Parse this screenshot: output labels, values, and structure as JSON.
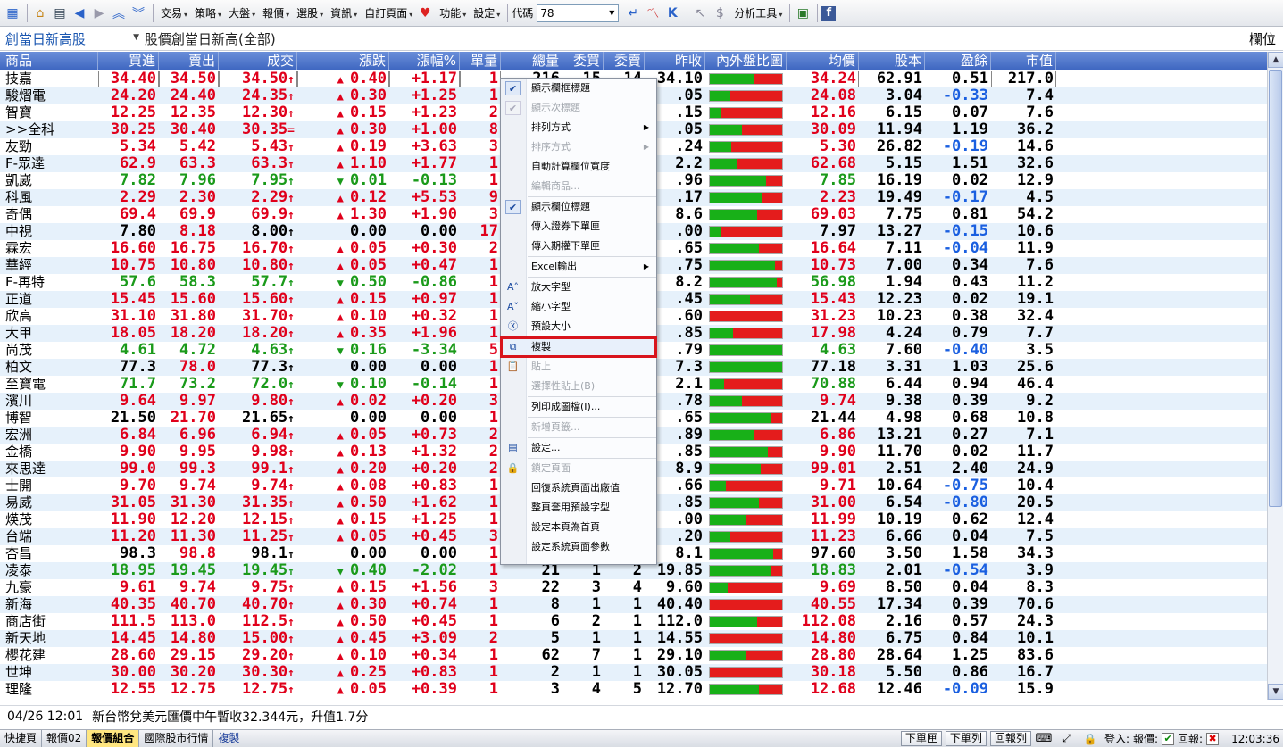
{
  "toolbar": {
    "menus": [
      "交易",
      "策略",
      "大盤",
      "報價",
      "選股",
      "資訊",
      "自訂頁面",
      "功能",
      "設定"
    ],
    "code_label": "代碼",
    "code_value": "78",
    "analysis_tools": "分析工具"
  },
  "page": {
    "selector": "創當日新高股",
    "title": "股價創當日新高(全部)",
    "columns_button": "欄位"
  },
  "columns": [
    "商品",
    "買進",
    "賣出",
    "成交",
    "漲跌",
    "漲幅%",
    "單量",
    "總量",
    "委買",
    "委賣",
    "昨收",
    "內外盤比圖",
    "均價",
    "股本",
    "盈餘",
    "市值"
  ],
  "rows": [
    {
      "name": "技嘉",
      "bid": "34.40",
      "ask": "34.50",
      "last": "34.50",
      "lastMark": "↑",
      "chg": "0.40",
      "dir": "up",
      "pct": "+1.17",
      "vol": "1",
      "total": "216",
      "bq": "15",
      "aq": "14",
      "prev": "34.10",
      "green": 0.62,
      "avg": "34.24",
      "cap": "62.91",
      "eps": "0.51",
      "mv": "217.0"
    },
    {
      "name": "駿熠電",
      "bid": "24.20",
      "ask": "24.40",
      "last": "24.35",
      "lastMark": "↑",
      "chg": "0.30",
      "dir": "up",
      "pct": "+1.25",
      "vol": "1",
      "total": "",
      "bq": "",
      "aq": "",
      "prev": ".05",
      "green": 0.28,
      "avg": "24.08",
      "cap": "3.04",
      "eps": "-0.33",
      "mv": "7.4"
    },
    {
      "name": "智寶",
      "bid": "12.25",
      "ask": "12.35",
      "last": "12.30",
      "lastMark": "↑",
      "chg": "0.15",
      "dir": "up",
      "pct": "+1.23",
      "vol": "2",
      "total": "",
      "bq": "",
      "aq": "",
      "prev": ".15",
      "green": 0.15,
      "avg": "12.16",
      "cap": "6.15",
      "eps": "0.07",
      "mv": "7.6"
    },
    {
      "name": ">>全科",
      "bid": "30.25",
      "ask": "30.40",
      "last": "30.35",
      "lastMark": "=",
      "chg": "0.30",
      "dir": "up",
      "pct": "+1.00",
      "vol": "8",
      "total": "",
      "bq": "",
      "aq": "",
      "prev": ".05",
      "green": 0.45,
      "avg": "30.09",
      "cap": "11.94",
      "eps": "1.19",
      "mv": "36.2"
    },
    {
      "name": "友勁",
      "bid": "5.34",
      "ask": "5.42",
      "last": "5.43",
      "lastMark": "↑",
      "chg": "0.19",
      "dir": "up",
      "pct": "+3.63",
      "vol": "3",
      "total": "",
      "bq": "",
      "aq": "",
      "prev": ".24",
      "green": 0.3,
      "avg": "5.30",
      "cap": "26.82",
      "eps": "-0.19",
      "mv": "14.6"
    },
    {
      "name": "F-眾達",
      "bid": "62.9",
      "ask": "63.3",
      "last": "63.3",
      "lastMark": "↑",
      "chg": "1.10",
      "dir": "up",
      "pct": "+1.77",
      "vol": "1",
      "total": "",
      "bq": "",
      "aq": "",
      "prev": "2.2",
      "green": 0.38,
      "avg": "62.68",
      "cap": "5.15",
      "eps": "1.51",
      "mv": "32.6"
    },
    {
      "name": "凱崴",
      "bid": "7.82",
      "ask": "7.96",
      "last": "7.95",
      "lastMark": "↑",
      "chg": "0.01",
      "dir": "down",
      "pct": "-0.13",
      "vol": "1",
      "total": "",
      "bq": "",
      "aq": "",
      "prev": ".96",
      "green": 0.78,
      "avg": "7.85",
      "cap": "16.19",
      "eps": "0.02",
      "mv": "12.9"
    },
    {
      "name": "科風",
      "bid": "2.29",
      "ask": "2.30",
      "last": "2.29",
      "lastMark": "↑",
      "chg": "0.12",
      "dir": "up",
      "pct": "+5.53",
      "vol": "9",
      "total": "",
      "bq": "",
      "aq": "",
      "prev": ".17",
      "green": 0.72,
      "avg": "2.23",
      "cap": "19.49",
      "eps": "-0.17",
      "mv": "4.5"
    },
    {
      "name": "奇偶",
      "bid": "69.4",
      "ask": "69.9",
      "last": "69.9",
      "lastMark": "↑",
      "chg": "1.30",
      "dir": "up",
      "pct": "+1.90",
      "vol": "3",
      "total": "",
      "bq": "",
      "aq": "",
      "prev": "8.6",
      "green": 0.65,
      "avg": "69.03",
      "cap": "7.75",
      "eps": "0.81",
      "mv": "54.2"
    },
    {
      "name": "中視",
      "bid": "7.80",
      "ask": "8.18",
      "last": "8.00",
      "lastMark": "↑",
      "chg": "0.00",
      "dir": "flat",
      "pct": "0.00",
      "vol": "17",
      "total": "",
      "bq": "",
      "aq": "",
      "prev": ".00",
      "green": 0.15,
      "avg": "7.97",
      "cap": "13.27",
      "eps": "-0.15",
      "mv": "10.6"
    },
    {
      "name": "霖宏",
      "bid": "16.60",
      "ask": "16.75",
      "last": "16.70",
      "lastMark": "↑",
      "chg": "0.05",
      "dir": "up",
      "pct": "+0.30",
      "vol": "2",
      "total": "",
      "bq": "",
      "aq": "",
      "prev": ".65",
      "green": 0.68,
      "avg": "16.64",
      "cap": "7.11",
      "eps": "-0.04",
      "mv": "11.9"
    },
    {
      "name": "華經",
      "bid": "10.75",
      "ask": "10.80",
      "last": "10.80",
      "lastMark": "↑",
      "chg": "0.05",
      "dir": "up",
      "pct": "+0.47",
      "vol": "1",
      "total": "",
      "bq": "",
      "aq": "",
      "prev": ".75",
      "green": 0.9,
      "avg": "10.73",
      "cap": "7.00",
      "eps": "0.34",
      "mv": "7.6"
    },
    {
      "name": "F-再特",
      "bid": "57.6",
      "ask": "58.3",
      "last": "57.7",
      "lastMark": "↑",
      "chg": "0.50",
      "dir": "down",
      "pct": "-0.86",
      "vol": "1",
      "total": "",
      "bq": "",
      "aq": "",
      "prev": "8.2",
      "green": 0.93,
      "avg": "56.98",
      "cap": "1.94",
      "eps": "0.43",
      "mv": "11.2"
    },
    {
      "name": "正道",
      "bid": "15.45",
      "ask": "15.60",
      "last": "15.60",
      "lastMark": "↑",
      "chg": "0.15",
      "dir": "up",
      "pct": "+0.97",
      "vol": "1",
      "total": "",
      "bq": "",
      "aq": "",
      "prev": ".45",
      "green": 0.55,
      "avg": "15.43",
      "cap": "12.23",
      "eps": "0.02",
      "mv": "19.1"
    },
    {
      "name": "欣高",
      "bid": "31.10",
      "ask": "31.80",
      "last": "31.70",
      "lastMark": "↑",
      "chg": "0.10",
      "dir": "up",
      "pct": "+0.32",
      "vol": "1",
      "total": "",
      "bq": "",
      "aq": "",
      "prev": ".60",
      "green": 0.0,
      "avg": "31.23",
      "cap": "10.23",
      "eps": "0.38",
      "mv": "32.4"
    },
    {
      "name": "大甲",
      "bid": "18.05",
      "ask": "18.20",
      "last": "18.20",
      "lastMark": "↑",
      "chg": "0.35",
      "dir": "up",
      "pct": "+1.96",
      "vol": "1",
      "total": "",
      "bq": "",
      "aq": "",
      "prev": ".85",
      "green": 0.32,
      "avg": "17.98",
      "cap": "4.24",
      "eps": "0.79",
      "mv": "7.7"
    },
    {
      "name": "尚茂",
      "bid": "4.61",
      "ask": "4.72",
      "last": "4.63",
      "lastMark": "↑",
      "chg": "0.16",
      "dir": "down",
      "pct": "-3.34",
      "vol": "5",
      "total": "",
      "bq": "",
      "aq": "",
      "prev": ".79",
      "green": 1.0,
      "avg": "4.63",
      "cap": "7.60",
      "eps": "-0.40",
      "mv": "3.5"
    },
    {
      "name": "柏文",
      "bid": "77.3",
      "ask": "78.0",
      "last": "77.3",
      "lastMark": "↑",
      "chg": "0.00",
      "dir": "flat",
      "pct": "0.00",
      "vol": "1",
      "total": "",
      "bq": "",
      "aq": "",
      "prev": "7.3",
      "green": 1.0,
      "avg": "77.18",
      "cap": "3.31",
      "eps": "1.03",
      "mv": "25.6"
    },
    {
      "name": "至寶電",
      "bid": "71.7",
      "ask": "73.2",
      "last": "72.0",
      "lastMark": "↑",
      "chg": "0.10",
      "dir": "down",
      "pct": "-0.14",
      "vol": "1",
      "total": "",
      "bq": "",
      "aq": "",
      "prev": "2.1",
      "green": 0.2,
      "avg": "70.88",
      "cap": "6.44",
      "eps": "0.94",
      "mv": "46.4"
    },
    {
      "name": "濱川",
      "bid": "9.64",
      "ask": "9.97",
      "last": "9.80",
      "lastMark": "↑",
      "chg": "0.02",
      "dir": "up",
      "pct": "+0.20",
      "vol": "3",
      "total": "",
      "bq": "",
      "aq": "",
      "prev": ".78",
      "green": 0.45,
      "avg": "9.74",
      "cap": "9.38",
      "eps": "0.39",
      "mv": "9.2"
    },
    {
      "name": "博智",
      "bid": "21.50",
      "ask": "21.70",
      "last": "21.65",
      "lastMark": "↑",
      "chg": "0.00",
      "dir": "flat",
      "pct": "0.00",
      "vol": "1",
      "total": "",
      "bq": "",
      "aq": "",
      "prev": ".65",
      "green": 0.85,
      "avg": "21.44",
      "cap": "4.98",
      "eps": "0.68",
      "mv": "10.8"
    },
    {
      "name": "宏洲",
      "bid": "6.84",
      "ask": "6.96",
      "last": "6.94",
      "lastMark": "↑",
      "chg": "0.05",
      "dir": "up",
      "pct": "+0.73",
      "vol": "2",
      "total": "",
      "bq": "",
      "aq": "",
      "prev": ".89",
      "green": 0.6,
      "avg": "6.86",
      "cap": "13.21",
      "eps": "0.27",
      "mv": "7.1"
    },
    {
      "name": "金橋",
      "bid": "9.90",
      "ask": "9.95",
      "last": "9.98",
      "lastMark": "↑",
      "chg": "0.13",
      "dir": "up",
      "pct": "+1.32",
      "vol": "2",
      "total": "",
      "bq": "",
      "aq": "",
      "prev": ".85",
      "green": 0.8,
      "avg": "9.90",
      "cap": "11.70",
      "eps": "0.02",
      "mv": "11.7"
    },
    {
      "name": "來思達",
      "bid": "99.0",
      "ask": "99.3",
      "last": "99.1",
      "lastMark": "↑",
      "chg": "0.20",
      "dir": "up",
      "pct": "+0.20",
      "vol": "2",
      "total": "",
      "bq": "",
      "aq": "",
      "prev": "8.9",
      "green": 0.7,
      "avg": "99.01",
      "cap": "2.51",
      "eps": "2.40",
      "mv": "24.9"
    },
    {
      "name": "士開",
      "bid": "9.70",
      "ask": "9.74",
      "last": "9.74",
      "lastMark": "↑",
      "chg": "0.08",
      "dir": "up",
      "pct": "+0.83",
      "vol": "1",
      "total": "",
      "bq": "",
      "aq": "",
      "prev": ".66",
      "green": 0.22,
      "avg": "9.71",
      "cap": "10.64",
      "eps": "-0.75",
      "mv": "10.4"
    },
    {
      "name": "易威",
      "bid": "31.05",
      "ask": "31.30",
      "last": "31.35",
      "lastMark": "↑",
      "chg": "0.50",
      "dir": "up",
      "pct": "+1.62",
      "vol": "1",
      "total": "",
      "bq": "",
      "aq": "",
      "prev": ".85",
      "green": 0.68,
      "avg": "31.00",
      "cap": "6.54",
      "eps": "-0.80",
      "mv": "20.5"
    },
    {
      "name": "煐茂",
      "bid": "11.90",
      "ask": "12.20",
      "last": "12.15",
      "lastMark": "↑",
      "chg": "0.15",
      "dir": "up",
      "pct": "+1.25",
      "vol": "1",
      "total": "",
      "bq": "",
      "aq": "",
      "prev": ".00",
      "green": 0.5,
      "avg": "11.99",
      "cap": "10.19",
      "eps": "0.62",
      "mv": "12.4"
    },
    {
      "name": "台端",
      "bid": "11.20",
      "ask": "11.30",
      "last": "11.25",
      "lastMark": "↑",
      "chg": "0.05",
      "dir": "up",
      "pct": "+0.45",
      "vol": "3",
      "total": "",
      "bq": "",
      "aq": "",
      "prev": ".20",
      "green": 0.28,
      "avg": "11.23",
      "cap": "6.66",
      "eps": "0.04",
      "mv": "7.5"
    },
    {
      "name": "杏昌",
      "bid": "98.3",
      "ask": "98.8",
      "last": "98.1",
      "lastMark": "↑",
      "chg": "0.00",
      "dir": "flat",
      "pct": "0.00",
      "vol": "1",
      "total": "",
      "bq": "",
      "aq": "",
      "prev": "8.1",
      "green": 0.88,
      "avg": "97.60",
      "cap": "3.50",
      "eps": "1.58",
      "mv": "34.3"
    },
    {
      "name": "凌泰",
      "bid": "18.95",
      "ask": "19.45",
      "last": "19.45",
      "lastMark": "↑",
      "chg": "0.40",
      "dir": "down",
      "pct": "-2.02",
      "vol": "1",
      "total": "21",
      "bq": "1",
      "aq": "2",
      "prev": "19.85",
      "green": 0.85,
      "avg": "18.83",
      "cap": "2.01",
      "eps": "-0.54",
      "mv": "3.9"
    },
    {
      "name": "九豪",
      "bid": "9.61",
      "ask": "9.74",
      "last": "9.75",
      "lastMark": "↑",
      "chg": "0.15",
      "dir": "up",
      "pct": "+1.56",
      "vol": "3",
      "total": "22",
      "bq": "3",
      "aq": "4",
      "prev": "9.60",
      "green": 0.25,
      "avg": "9.69",
      "cap": "8.50",
      "eps": "0.04",
      "mv": "8.3"
    },
    {
      "name": "新海",
      "bid": "40.35",
      "ask": "40.70",
      "last": "40.70",
      "lastMark": "↑",
      "chg": "0.30",
      "dir": "up",
      "pct": "+0.74",
      "vol": "1",
      "total": "8",
      "bq": "1",
      "aq": "1",
      "prev": "40.40",
      "green": 0.0,
      "avg": "40.55",
      "cap": "17.34",
      "eps": "0.39",
      "mv": "70.6"
    },
    {
      "name": "商店街",
      "bid": "111.5",
      "ask": "113.0",
      "last": "112.5",
      "lastMark": "↑",
      "chg": "0.50",
      "dir": "up",
      "pct": "+0.45",
      "vol": "1",
      "total": "6",
      "bq": "2",
      "aq": "1",
      "prev": "112.0",
      "green": 0.65,
      "avg": "112.08",
      "cap": "2.16",
      "eps": "0.57",
      "mv": "24.3"
    },
    {
      "name": "新天地",
      "bid": "14.45",
      "ask": "14.80",
      "last": "15.00",
      "lastMark": "↑",
      "chg": "0.45",
      "dir": "up",
      "pct": "+3.09",
      "vol": "2",
      "total": "5",
      "bq": "1",
      "aq": "1",
      "prev": "14.55",
      "green": 0.0,
      "avg": "14.80",
      "cap": "6.75",
      "eps": "0.84",
      "mv": "10.1"
    },
    {
      "name": "櫻花建",
      "bid": "28.60",
      "ask": "29.15",
      "last": "29.20",
      "lastMark": "↑",
      "chg": "0.10",
      "dir": "up",
      "pct": "+0.34",
      "vol": "1",
      "total": "62",
      "bq": "7",
      "aq": "1",
      "prev": "29.10",
      "green": 0.5,
      "avg": "28.80",
      "cap": "28.64",
      "eps": "1.25",
      "mv": "83.6"
    },
    {
      "name": "世坤",
      "bid": "30.00",
      "ask": "30.20",
      "last": "30.30",
      "lastMark": "↑",
      "chg": "0.25",
      "dir": "up",
      "pct": "+0.83",
      "vol": "1",
      "total": "2",
      "bq": "1",
      "aq": "1",
      "prev": "30.05",
      "green": 0.0,
      "avg": "30.18",
      "cap": "5.50",
      "eps": "0.86",
      "mv": "16.7"
    },
    {
      "name": "理隆",
      "bid": "12.55",
      "ask": "12.75",
      "last": "12.75",
      "lastMark": "↑",
      "chg": "0.05",
      "dir": "up",
      "pct": "+0.39",
      "vol": "1",
      "total": "3",
      "bq": "4",
      "aq": "5",
      "prev": "12.70",
      "green": 0.68,
      "avg": "12.68",
      "cap": "12.46",
      "eps": "-0.09",
      "mv": "15.9"
    }
  ],
  "context_menu": [
    {
      "label": "顯示欄框標題",
      "icon": "check",
      "enabled": true
    },
    {
      "label": "顯示次標題",
      "icon": "check",
      "enabled": false
    },
    {
      "label": "排列方式",
      "enabled": true,
      "submenu": true
    },
    {
      "label": "排序方式",
      "enabled": false,
      "submenu": true
    },
    {
      "label": "自動計算欄位寬度",
      "enabled": true
    },
    {
      "label": "編輯商品...",
      "enabled": false,
      "sep_after": true
    },
    {
      "label": "顯示欄位標題",
      "icon": "check",
      "enabled": true
    },
    {
      "label": "傳入證券下單匣",
      "enabled": true
    },
    {
      "label": "傳入期權下單匣",
      "enabled": true,
      "sep_after": true
    },
    {
      "label": "Excel輸出",
      "enabled": true,
      "submenu": true,
      "sep_after": true
    },
    {
      "label": "放大字型",
      "icon": "font-up",
      "enabled": true
    },
    {
      "label": "縮小字型",
      "icon": "font-down",
      "enabled": true
    },
    {
      "label": "預設大小",
      "icon": "font-reset",
      "enabled": true,
      "sep_after": true
    },
    {
      "label": "複製",
      "icon": "copy",
      "enabled": true,
      "highlight": true
    },
    {
      "label": "貼上",
      "icon": "paste",
      "enabled": false
    },
    {
      "label": "選擇性貼上(B)",
      "enabled": false,
      "sep_after": true
    },
    {
      "label": "列印成圖檔(I)...",
      "enabled": true,
      "sep_after": true
    },
    {
      "label": "新增頁籤...",
      "enabled": false,
      "sep_after": true
    },
    {
      "label": "設定...",
      "icon": "settings",
      "enabled": true,
      "sep_after": true
    },
    {
      "label": "鎖定頁面",
      "icon": "lock",
      "enabled": false
    },
    {
      "label": "回復系統頁面出廠值",
      "enabled": true
    },
    {
      "label": "整頁套用預設字型",
      "enabled": true
    },
    {
      "label": "設定本頁為首頁",
      "enabled": true
    },
    {
      "label": "設定系統頁面參數",
      "enabled": true
    }
  ],
  "news": {
    "time": "04/26 12:01",
    "text": "新台幣兌美元匯價中午暫收32.344元，升值1.7分"
  },
  "status": {
    "tabs": [
      "快捷頁",
      "報價02",
      "報價組合",
      "國際股市行情"
    ],
    "active_tab": "報價組合",
    "copy_link": "複製",
    "buttons": [
      "下單匣",
      "下單列",
      "回報列"
    ],
    "login_label": "登入:",
    "quote_label": "報價:",
    "report_label": "回報:",
    "clock": "12:03:36"
  }
}
